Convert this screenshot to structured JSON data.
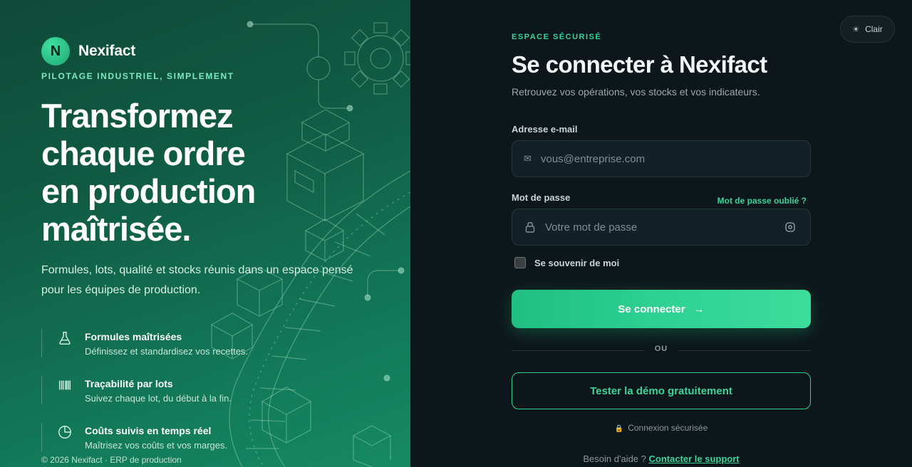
{
  "brand": {
    "logo_letter": "N",
    "name": "Nexifact"
  },
  "hero": {
    "tagline": "PILOTAGE INDUSTRIEL, SIMPLEMENT",
    "headline_lines": [
      "Transformez",
      "chaque ordre",
      "en production",
      "maîtrisée."
    ],
    "subtitle": "Formules, lots, qualité et stocks réunis dans un espace pensé pour les équipes de production."
  },
  "features": [
    {
      "icon": "flask-icon",
      "title": "Formules maîtrisées",
      "desc": "Définissez et standardisez vos recettes."
    },
    {
      "icon": "barcode-icon",
      "title": "Traçabilité par lots",
      "desc": "Suivez chaque lot, du début à la fin."
    },
    {
      "icon": "pie-chart-icon",
      "title": "Coûts suivis en temps réel",
      "desc": "Maîtrisez vos coûts et vos marges."
    }
  ],
  "footer": {
    "copyright": "© 2026 Nexifact · ERP de production"
  },
  "theme_toggle": {
    "icon": "sun-icon",
    "label": "Clair"
  },
  "login": {
    "eyebrow": "ESPACE SÉCURISÉ",
    "title": "Se connecter à Nexifact",
    "lead": "Retrouvez vos opérations, vos stocks et vos indicateurs.",
    "email": {
      "label": "Adresse e-mail",
      "placeholder": "vous@entreprise.com",
      "icon": "mail-icon"
    },
    "password": {
      "label": "Mot de passe",
      "placeholder": "Votre mot de passe",
      "icon": "lock-icon",
      "toggle_icon": "eye-icon",
      "forgot": "Mot de passe oublié ?"
    },
    "remember": "Se souvenir de moi",
    "submit": "Se connecter",
    "divider": "OU",
    "demo": "Tester la démo gratuitement",
    "secure": "Connexion sécurisée",
    "help_prefix": "Besoin d'aide ?",
    "help_link": "Contacter le support"
  },
  "colors": {
    "accent": "#3ad49a",
    "panel_left": "#127556",
    "panel_right": "#0d171b"
  }
}
